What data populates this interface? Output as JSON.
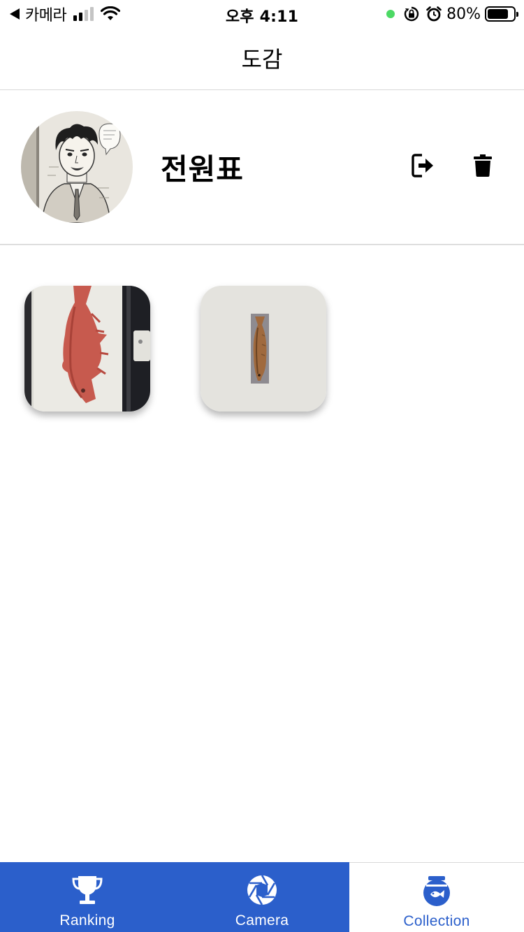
{
  "status_bar": {
    "back_label": "카메라",
    "time": "오후 4:11",
    "battery_percent": "80%",
    "battery_level": 0.8,
    "icons": [
      "back-caret-icon",
      "cellular-signal-icon",
      "wifi-icon",
      "green-dot-icon",
      "orientation-lock-icon",
      "alarm-icon",
      "battery-icon"
    ]
  },
  "header": {
    "title": "도감"
  },
  "profile": {
    "name": "전원표",
    "avatar_icon": "manga-character-avatar",
    "logout_icon": "logout-icon",
    "delete_icon": "trash-icon"
  },
  "collection": {
    "items": [
      {
        "icon": "red-fish-photo"
      },
      {
        "icon": "brown-fish-photo"
      }
    ]
  },
  "tab_bar": {
    "tabs": [
      {
        "label": "Ranking",
        "icon": "trophy-icon"
      },
      {
        "label": "Camera",
        "icon": "aperture-icon"
      },
      {
        "label": "Collection",
        "icon": "fishbowl-icon"
      }
    ],
    "active_index": 2
  },
  "colors": {
    "accent": "#2b5fcb",
    "divider": "#d8d8d8",
    "status_dot": "#4cd964"
  }
}
